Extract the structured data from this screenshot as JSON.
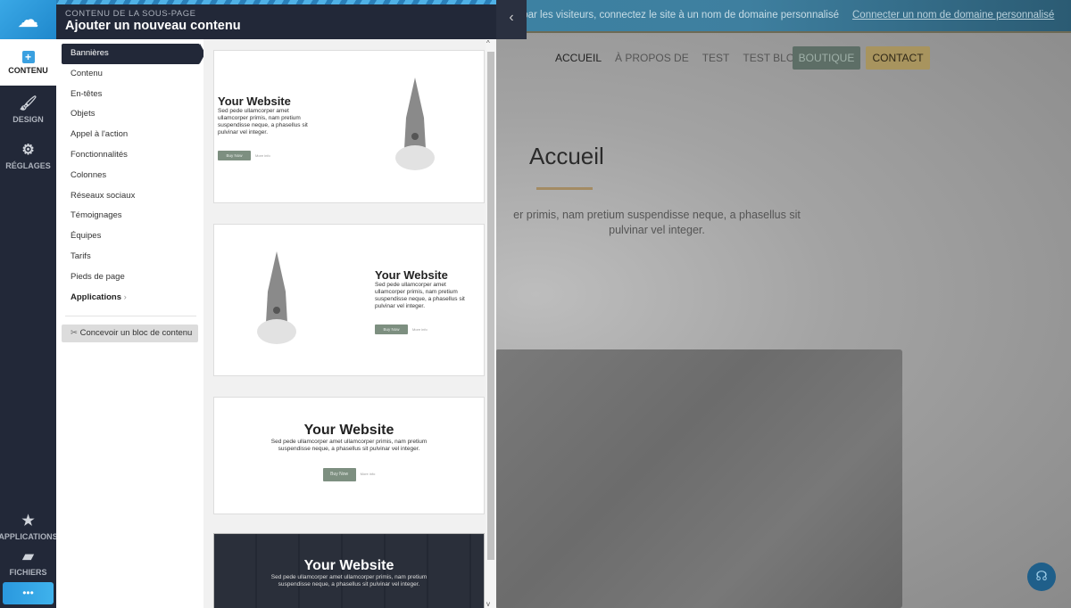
{
  "site": {
    "banner_message": "Le site n'est pas encore visible par les visiteurs, connectez le site à un nom de domaine personnalisé.",
    "banner_link": "Connecter un nom de domaine personnalisé",
    "nav": [
      "ACCUEIL",
      "À PROPOS DE",
      "TEST",
      "TEST BLOG"
    ],
    "boutique": "BOUTIQUE",
    "contact": "CONTACT",
    "heading": "Accueil",
    "paragraph": "er primis, nam pretium suspendisse neque, a phasellus sit pulvinar vel integer.",
    "accent_color": "#a38b63"
  },
  "rail": {
    "tabs": [
      {
        "label": "CONTENU",
        "icon": "plus-icon"
      },
      {
        "label": "DESIGN",
        "icon": "brush-icon"
      },
      {
        "label": "RÉGLAGES",
        "icon": "gears-icon"
      }
    ],
    "bottom": [
      {
        "label": "APPLICATIONS",
        "icon": "star-icon"
      },
      {
        "label": "FICHIERS",
        "icon": "folder-icon"
      }
    ],
    "more": "•••"
  },
  "panel": {
    "subtitle": "CONTENU DE LA SOUS-PAGE",
    "title": "Ajouter un nouveau contenu",
    "categories": [
      "Bannières",
      "Contenu",
      "En-têtes",
      "Objets",
      "Appel à l'action",
      "Fonctionnalités",
      "Colonnes",
      "Réseaux sociaux",
      "Témoignages",
      "Équipes",
      "Tarifs",
      "Pieds de page"
    ],
    "applications": "Applications",
    "design_block": "Concevoir un bloc de contenu"
  },
  "preview": {
    "title": "Your Website",
    "text": "Sed pede ullamcorper amet ullamcorper primis, nam pretium suspendisse neque, a phasellus sit pulvinar vel integer.",
    "buy": "Buy Now",
    "more": "More info"
  }
}
